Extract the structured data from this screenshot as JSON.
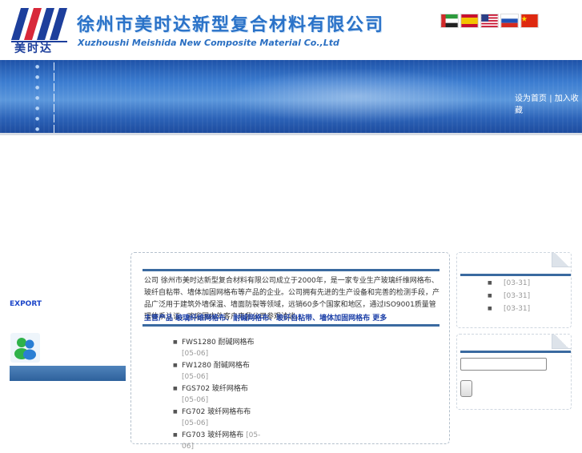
{
  "header": {
    "logo_text": "美时达",
    "company_cn": "徐州市美时达新型复合材料有限公司",
    "company_en": "Xuzhoushi Meishida New Composite Material Co.,Ltd",
    "flags": [
      "flag-arabic-icon",
      "flag-spain-icon",
      "flag-usa-icon",
      "flag-russia-icon",
      "flag-china-icon"
    ]
  },
  "banner": {
    "nav_dot_count": 8,
    "top_links": {
      "left": "设为首页",
      "separator": "|",
      "right": "加入收藏"
    }
  },
  "left": {
    "export_label": "EXPORT",
    "im_icon": "msn-messenger-icon"
  },
  "main": {
    "intro": "公司 徐州市美时达新型复合材料有限公司成立于2000年，是一家专业生产玻璃纤维网格布、玻纤自粘带、墙体加固网格布等产品的企业。公司拥有先进的生产设备和完善的检测手段，产品广泛用于建筑外墙保温、墙面防裂等领域，远销60多个国家和地区，通过ISO9001质量管理体系认证，欢迎国内外客户来我公司参观洽谈。",
    "more_line": "主营产品 玻璃纤维网格布、耐碱网格布、玻纤自粘带、墙体加固网格布  更多",
    "products": [
      {
        "name": "FWS1280 耐碱网格布",
        "date": "[05-06]"
      },
      {
        "name": "FW1280 耐碱网格布",
        "date": "[05-06]"
      },
      {
        "name": "FGS702 玻纤网格布",
        "date": "[05-06]"
      },
      {
        "name": "FG702 玻纤网格布布",
        "date": "[05-06]"
      },
      {
        "name": "FG703 玻纤网格布",
        "date": "[05-06]"
      }
    ]
  },
  "sidebar": {
    "news": [
      {
        "date": "[03-31]"
      },
      {
        "date": "[03-31]"
      },
      {
        "date": "[03-31]"
      }
    ],
    "search": {
      "placeholder": "",
      "button_label": ""
    }
  },
  "colors": {
    "brand_blue": "#2a72c8",
    "banner_blue": "#3b7cd0",
    "rule": "#3a6aa0",
    "export": "#1c46c9"
  }
}
